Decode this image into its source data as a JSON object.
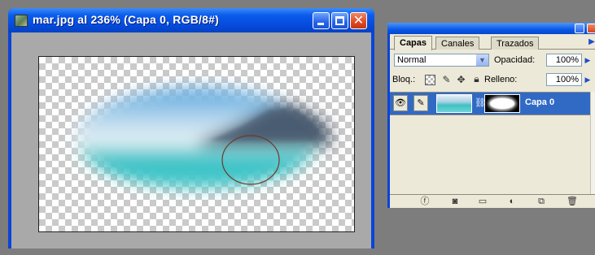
{
  "document": {
    "title": "mar.jpg al 236% (Capa 0, RGB/8#)",
    "icon": "image-file-icon"
  },
  "palette": {
    "tabs": [
      {
        "label": "Capas",
        "active": true
      },
      {
        "label": "Canales",
        "active": false
      },
      {
        "label": "Trazados",
        "active": false
      }
    ],
    "blend_mode": "Normal",
    "opacity_label": "Opacidad:",
    "opacity_value": "100%",
    "lock_label": "Bloq.:",
    "fill_label": "Relleno:",
    "fill_value": "100%",
    "layers": [
      {
        "name": "Capa 0",
        "visible": true,
        "selected": true,
        "has_mask": true
      }
    ],
    "footer_icons": [
      "link-layers-icon",
      "layer-style-icon",
      "add-mask-icon",
      "new-group-icon",
      "adjustment-layer-icon",
      "new-layer-icon",
      "trash-icon"
    ]
  },
  "colors": {
    "xp_titlebar": "#0a5bec",
    "selected_layer": "#316ac5",
    "palette_bg": "#ece9d8"
  }
}
